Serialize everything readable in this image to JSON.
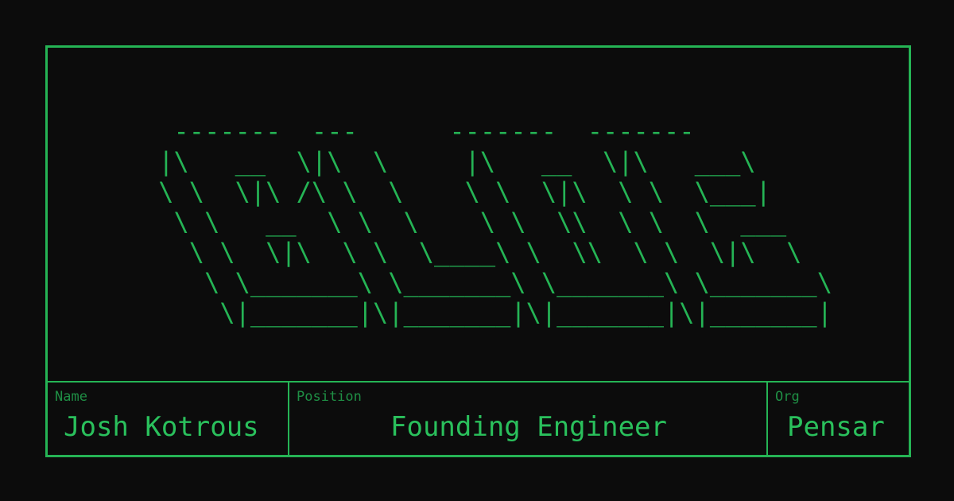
{
  "ascii_art": {
    "lines": [
      "  -------  ---      -------  -------",
      " |\\   __  \\|\\  \\     |\\   __  \\|\\   ___\\",
      " \\ \\  \\|\\ /\\ \\  \\    \\ \\  \\|\\  \\ \\  \\___|",
      "  \\ \\   __  \\ \\  \\    \\ \\  \\\\  \\ \\  \\  ___",
      "   \\ \\  \\|\\  \\ \\  \\____\\ \\  \\\\  \\ \\  \\|\\  \\",
      "    \\ \\_______\\ \\_______\\ \\_______\\ \\_______\\",
      "     \\|_______|\\|_______|\\|_______|\\|_______|"
    ]
  },
  "fields": {
    "name": {
      "label": "Name",
      "value": "Josh Kotrous"
    },
    "position": {
      "label": "Position",
      "value": "Founding Engineer"
    },
    "org": {
      "label": "Org",
      "value": "Pensar"
    }
  },
  "colors": {
    "background": "#0c0c0c",
    "accent": "#25b455",
    "label": "#1f8f45"
  }
}
